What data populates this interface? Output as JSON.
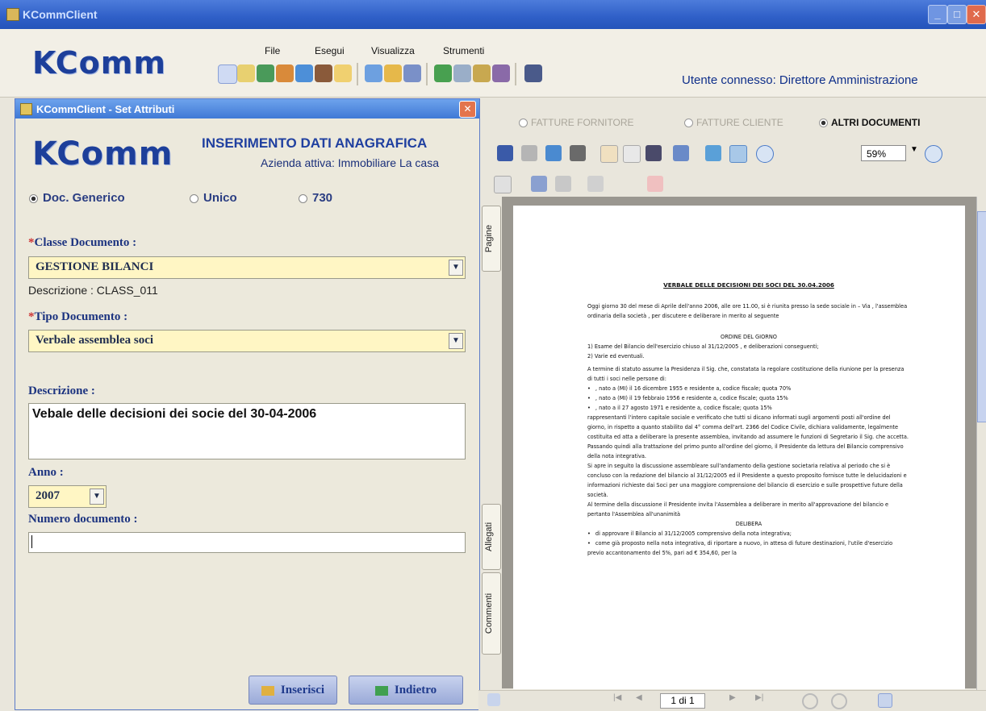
{
  "window": {
    "title": "KCommClient"
  },
  "header": {
    "logo": "KComm",
    "menu": [
      "File",
      "Esegui",
      "Visualizza",
      "Strumenti"
    ],
    "user_status": "Utente connesso: Direttore Amministrazione"
  },
  "dialog": {
    "title": "KCommClient - Set Attributi",
    "logo": "KComm",
    "heading": "INSERIMENTO DATI ANAGRAFICA",
    "company": "Azienda attiva: Immobiliare La casa",
    "doc_types": [
      "Doc. Generico",
      "Unico",
      "730"
    ],
    "selected_doc_type": "Doc. Generico",
    "classe_label": "Classe Documento :",
    "classe_value": "GESTIONE BILANCI",
    "descrizione_classe": "Descrizione : CLASS_011",
    "tipo_label": "Tipo Documento :",
    "tipo_value": "Verbale assemblea soci",
    "descrizione_label": "Descrizione :",
    "descrizione_value": "Vebale delle decisioni dei socie del 30-04-2006",
    "anno_label": "Anno :",
    "anno_value": "2007",
    "numero_label": "Numero documento :",
    "numero_value": "",
    "insert_button": "Inserisci",
    "back_button": "Indietro"
  },
  "viewer": {
    "doc_filters": [
      "FATTURE FORNITORE",
      "FATTURE CLIENTE",
      "ALTRI DOCUMENTI"
    ],
    "selected_filter": "ALTRI DOCUMENTI",
    "zoom": "59%",
    "side_tabs": [
      "Pagine",
      "Allegati",
      "Commenti"
    ],
    "page_indicator": "1 di 1"
  },
  "document": {
    "title": "VERBALE DELLE DECISIONI DEI SOCI DEL 30.04.2006",
    "intro": "Oggi giorno 30 del mese di Aprile dell'anno 2006, alle ore 11.00, si è riunita presso la sede sociale in – Via , l'assemblea ordinaria della società , per discutere e deliberare in merito al seguente",
    "ordine": "ORDINE DEL GIORNO",
    "points": [
      "1) Esame del Bilancio dell'esercizio chiuso al 31/12/2005 , e deliberazioni conseguenti;",
      "2) Varie ed eventuali."
    ],
    "para1": "A termine di statuto assume la Presidenza il Sig. che, constatata la regolare costituzione della riunione per la presenza di tutti i soci nelle persone di:",
    "soci": [
      ", nato a (MI) il 16 dicembre 1955 e residente a, codice fiscale; quota 70%",
      ", nato a (MI) il 19 febbraio 1956 e residente a, codice fiscale; quota 15%",
      ", nato a il 27 agosto 1971 e residente a, codice fiscale; quota 15%"
    ],
    "para2": "rappresentanti l'intero capitale sociale e verificato che tutti si dicano informati sugli argomenti posti all'ordine del giorno, in rispetto a quanto stabilito dal 4° comma dell'art. 2366 del Codice Civile, dichiara validamente, legalmente costituita ed atta a deliberare la presente assemblea, invitando ad assumere le funzioni di Segretario il Sig. che accetta.",
    "para3": "Passando quindi alla trattazione del primo punto all'ordine del giorno, il Presidente da lettura del Bilancio comprensivo della nota integrativa.",
    "para4": "Si apre in seguito la discussione assembleare sull'andamento della gestione societaria relativa al periodo che si è concluso con la redazione del bilancio al 31/12/2005 ed il Presidente a questo proposito fornisce tutte le delucidazioni e informazioni richieste dai Soci per una maggiore comprensione del bilancio di esercizio e sulle prospettive future della società.",
    "para5": "Al termine della discussione il Presidente invita l'Assemblea a deliberare in merito all'approvazione del bilancio e pertanto l'Assemblea all'unanimità",
    "delibera": "DELIBERA",
    "bullets": [
      "di approvare il Bilancio al 31/12/2005 comprensivo della nota integrativa;",
      "come già proposto nella nota integrativa, di riportare a nuovo, in attesa di future destinazioni, l'utile d'esercizio previo accantonamento del 5%, pari ad € 354,60, per la"
    ]
  },
  "colors": {
    "title_bar": "#2f5fc7",
    "combo_bg": "#fff6c4",
    "label_blue": "#1d3480",
    "button_blue": "#9aaad8"
  }
}
